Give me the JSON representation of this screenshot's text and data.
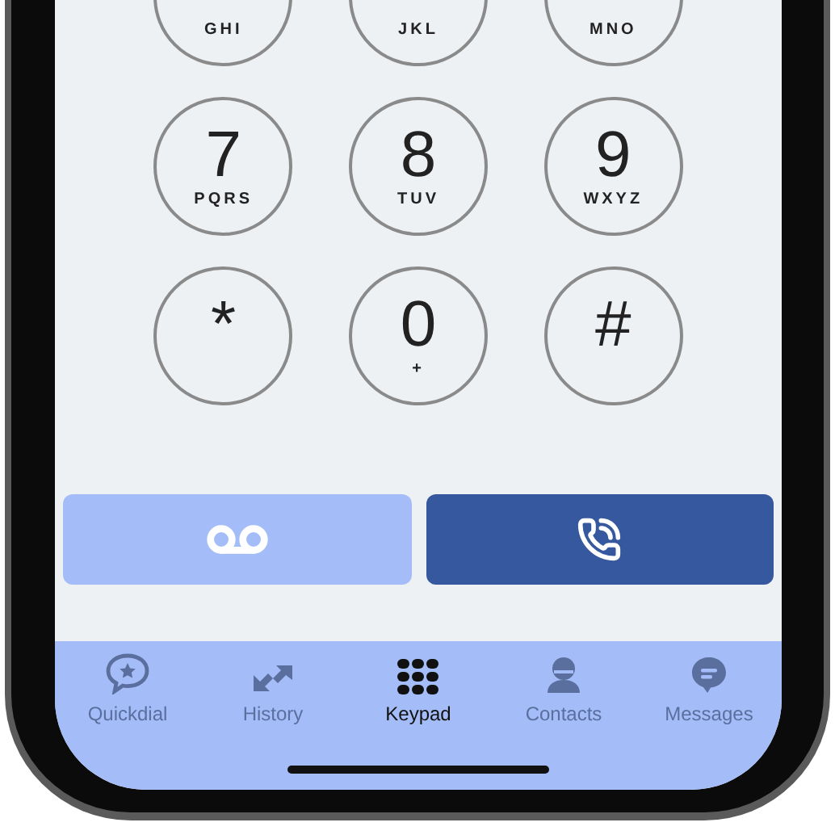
{
  "keypad": [
    {
      "letters": "GHI"
    },
    {
      "letters": "JKL"
    },
    {
      "letters": "MNO"
    },
    {
      "digit": "7",
      "letters": "PQRS"
    },
    {
      "digit": "8",
      "letters": "TUV"
    },
    {
      "digit": "9",
      "letters": "WXYZ"
    },
    {
      "digit": "*"
    },
    {
      "digit": "0",
      "letters": "+"
    },
    {
      "digit": "#"
    }
  ],
  "actions": [
    {
      "kind": "voicemail"
    },
    {
      "kind": "call"
    }
  ],
  "tabs": [
    {
      "kind": "quickdial",
      "label": "Quickdial",
      "selected": false
    },
    {
      "kind": "history",
      "label": "History",
      "selected": false
    },
    {
      "kind": "keypad",
      "label": "Keypad",
      "selected": true
    },
    {
      "kind": "contacts",
      "label": "Contacts",
      "selected": false
    },
    {
      "kind": "messages",
      "label": "Messages",
      "selected": false
    }
  ]
}
